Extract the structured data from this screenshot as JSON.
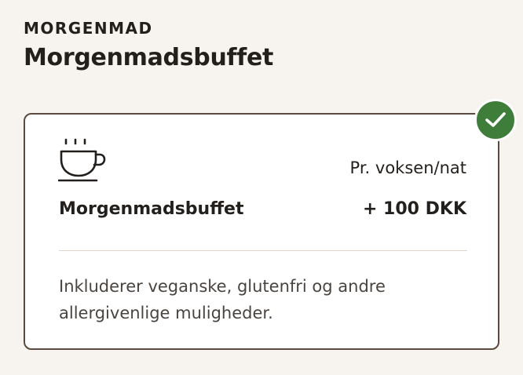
{
  "section": {
    "eyebrow": "MORGENMAD",
    "title": "Morgenmadsbuffet"
  },
  "option": {
    "icon": "coffee-cup-icon",
    "selected": true,
    "selected_icon": "checkmark-icon",
    "unit_label": "Pr. voksen/nat",
    "name": "Morgenmadsbuffet",
    "price": "+ 100 DKK",
    "description": "Inkluderer veganske, glutenfri og andre allergivenlige muligheder."
  },
  "colors": {
    "background": "#f7f3ef",
    "card_border": "#5b4a3f",
    "selected_badge": "#3e7d3a",
    "text": "#231f1c"
  }
}
